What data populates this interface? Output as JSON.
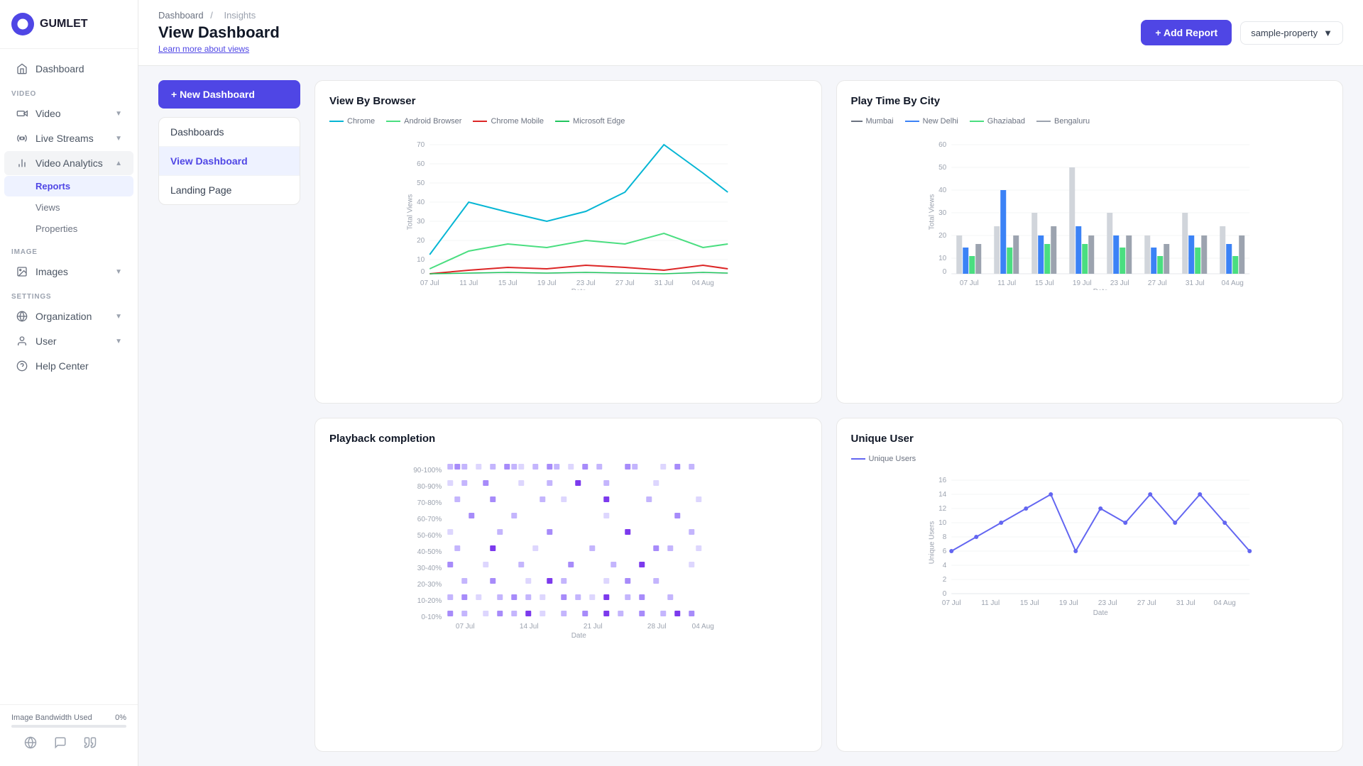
{
  "logo": {
    "text": "GUMLET"
  },
  "sidebar": {
    "sections": [
      {
        "label": "VIDEO",
        "items": [
          {
            "id": "dashboard",
            "label": "Dashboard",
            "icon": "home",
            "hasChildren": false
          },
          {
            "id": "video",
            "label": "Video",
            "icon": "video",
            "hasChildren": true
          },
          {
            "id": "live-streams",
            "label": "Live Streams",
            "icon": "live",
            "hasChildren": true
          },
          {
            "id": "video-analytics",
            "label": "Video Analytics",
            "icon": "analytics",
            "hasChildren": true,
            "active": true,
            "children": [
              {
                "id": "reports",
                "label": "Reports",
                "active": true
              },
              {
                "id": "views",
                "label": "Views"
              },
              {
                "id": "properties",
                "label": "Properties"
              }
            ]
          }
        ]
      },
      {
        "label": "IMAGE",
        "items": [
          {
            "id": "images",
            "label": "Images",
            "icon": "image",
            "hasChildren": true
          }
        ]
      },
      {
        "label": "SETTINGS",
        "items": [
          {
            "id": "organization",
            "label": "Organization",
            "icon": "org",
            "hasChildren": true
          },
          {
            "id": "user",
            "label": "User",
            "icon": "user",
            "hasChildren": true
          },
          {
            "id": "help-center",
            "label": "Help Center",
            "icon": "help",
            "hasChildren": false
          }
        ]
      }
    ],
    "bandwidth": {
      "label": "Image Bandwidth Used",
      "value": "0%",
      "fill": 0
    },
    "bottom_icons": [
      "globe",
      "chat",
      "quote"
    ]
  },
  "header": {
    "breadcrumb": [
      "Dashboard",
      "Insights"
    ],
    "title": "View Dashboard",
    "learn_link": "Learn more about views",
    "add_report_label": "+ Add Report",
    "property_label": "sample-property"
  },
  "left_panel": {
    "new_dashboard_label": "+ New Dashboard",
    "menu_items": [
      {
        "id": "dashboards",
        "label": "Dashboards",
        "active": false
      },
      {
        "id": "view-dashboard",
        "label": "View Dashboard",
        "active": true
      },
      {
        "id": "landing-page",
        "label": "Landing Page",
        "active": false
      }
    ]
  },
  "charts": {
    "view_by_browser": {
      "title": "View By Browser",
      "legend": [
        {
          "label": "Chrome",
          "color": "#06b6d4",
          "type": "line"
        },
        {
          "label": "Android Browser",
          "color": "#4ade80",
          "type": "line"
        },
        {
          "label": "Chrome Mobile",
          "color": "#dc2626",
          "type": "line"
        },
        {
          "label": "Microsoft Edge",
          "color": "#22c55e",
          "type": "line"
        }
      ],
      "x_labels": [
        "07 Jul",
        "11 Jul",
        "15 Jul",
        "19 Jul",
        "23 Jul",
        "27 Jul",
        "31 Jul",
        "04 Aug"
      ],
      "y_label": "Total Views",
      "x_label": "Date",
      "y_max": 70
    },
    "play_time_by_city": {
      "title": "Play Time By City",
      "legend": [
        {
          "label": "Mumbai",
          "color": "#6b7280",
          "type": "dash"
        },
        {
          "label": "New Delhi",
          "color": "#3b82f6",
          "type": "line"
        },
        {
          "label": "Ghaziabad",
          "color": "#4ade80",
          "type": "line"
        },
        {
          "label": "Bengaluru",
          "color": "#9ca3af",
          "type": "line"
        }
      ],
      "x_labels": [
        "07 Jul",
        "11 Jul",
        "15 Jul",
        "19 Jul",
        "23 Jul",
        "27 Jul",
        "31 Jul",
        "04 Aug"
      ],
      "y_label": "Total Views",
      "x_label": "Date",
      "y_max": 60
    },
    "playback_completion": {
      "title": "Playback completion",
      "y_labels": [
        "90-100%",
        "80-90%",
        "70-80%",
        "60-70%",
        "50-60%",
        "40-50%",
        "30-40%",
        "20-30%",
        "10-20%",
        "0-10%"
      ],
      "x_labels": [
        "07 Jul",
        "14 Jul",
        "21 Jul",
        "28 Jul",
        "04 Aug"
      ],
      "x_label": "Date"
    },
    "unique_user": {
      "title": "Unique User",
      "legend": [
        {
          "label": "Unique Users",
          "color": "#6366f1",
          "type": "line"
        }
      ],
      "x_labels": [
        "07 Jul",
        "11 Jul",
        "15 Jul",
        "19 Jul",
        "23 Jul",
        "27 Jul",
        "31 Jul",
        "04 Aug"
      ],
      "y_label": "Unique Users",
      "x_label": "Date",
      "y_max": 16
    }
  }
}
